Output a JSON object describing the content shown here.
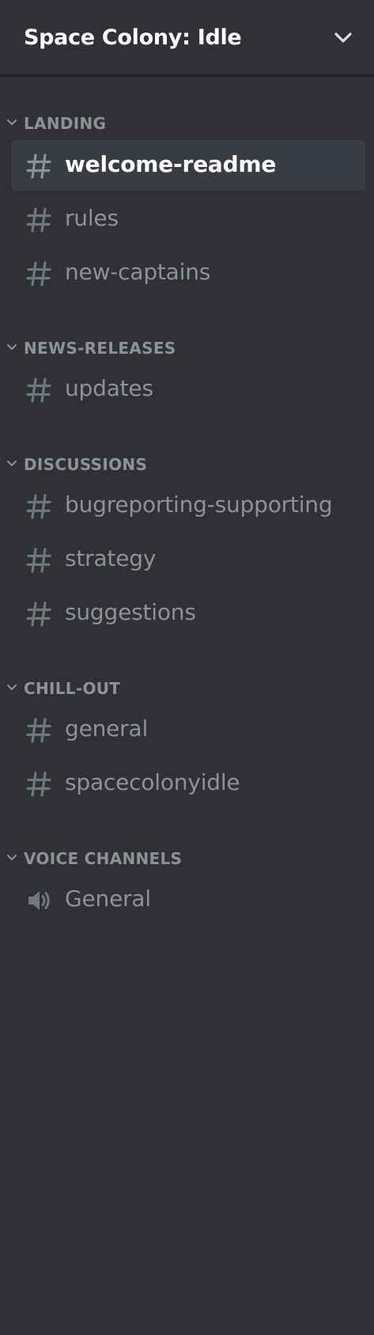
{
  "server": {
    "name": "Space Colony: Idle"
  },
  "categories": [
    {
      "label": "LANDING",
      "channels": [
        {
          "label": "welcome-readme",
          "type": "text",
          "selected": true
        },
        {
          "label": "rules",
          "type": "text"
        },
        {
          "label": "new-captains",
          "type": "text"
        }
      ]
    },
    {
      "label": "NEWS-RELEASES",
      "channels": [
        {
          "label": "updates",
          "type": "text"
        }
      ]
    },
    {
      "label": "DISCUSSIONS",
      "channels": [
        {
          "label": "bugreporting-supporting",
          "type": "text"
        },
        {
          "label": "strategy",
          "type": "text"
        },
        {
          "label": "suggestions",
          "type": "text"
        }
      ]
    },
    {
      "label": "CHILL-OUT",
      "channels": [
        {
          "label": "general",
          "type": "text"
        },
        {
          "label": "spacecolonyidle",
          "type": "text"
        }
      ]
    },
    {
      "label": "VOICE CHANNELS",
      "channels": [
        {
          "label": "General",
          "type": "voice"
        }
      ]
    }
  ],
  "icons": {
    "text_channel": "hash-icon",
    "voice_channel": "speaker-icon",
    "category_toggle": "chevron-down-icon",
    "server_menu": "chevron-down-icon"
  },
  "colors": {
    "background": "#2f3136",
    "selected_background": "#393c43",
    "text_muted": "#8e9297",
    "text_active": "#ffffff"
  }
}
